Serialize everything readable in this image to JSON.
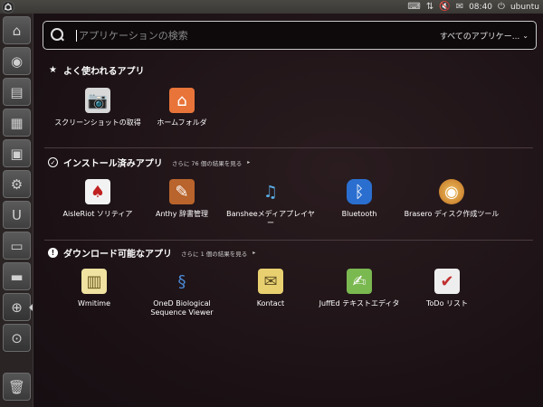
{
  "panel": {
    "clock": "08:40",
    "user": "ubuntu"
  },
  "search": {
    "placeholder": "アプリケーションの検索",
    "filter_label": "すべてのアプリケー..."
  },
  "sections": [
    {
      "title": "よく使われるアプリ",
      "more": "",
      "apps": [
        {
          "label": "スクリーンショットの取得",
          "icon": "camera-icon"
        },
        {
          "label": "ホームフォルダ",
          "icon": "home-folder-icon"
        }
      ]
    },
    {
      "title": "インストール済みアプリ",
      "more": "さらに 76 個の結果を見る",
      "apps": [
        {
          "label": "AisleRiot ソリティア",
          "icon": "cards-icon"
        },
        {
          "label": "Anthy 辞書管理",
          "icon": "dictionary-icon"
        },
        {
          "label": "Bansheeメディアプレイヤー",
          "icon": "banshee-icon"
        },
        {
          "label": "Bluetooth",
          "icon": "bluetooth-icon"
        },
        {
          "label": "Brasero ディスク作成ツール",
          "icon": "brasero-icon"
        }
      ]
    },
    {
      "title": "ダウンロード可能なアプリ",
      "more": "さらに 1 個の結果を見る",
      "apps": [
        {
          "label": "Wmitime",
          "icon": "wmitime-icon"
        },
        {
          "label": "OneD Biological Sequence Viewer",
          "icon": "onedbio-icon"
        },
        {
          "label": "Kontact",
          "icon": "kontact-icon"
        },
        {
          "label": "JuffEd テキストエディタ",
          "icon": "juffed-icon"
        },
        {
          "label": "ToDo リスト",
          "icon": "todo-icon"
        }
      ]
    }
  ],
  "launcher": {
    "items": [
      "home-folder-icon",
      "firefox-icon",
      "writer-icon",
      "calc-icon",
      "impress-icon",
      "settings-icon",
      "ubuntu-one-icon",
      "workspaces-icon",
      "terminal-icon",
      "zoom-in-icon",
      "zoom-icon",
      "trash-icon"
    ]
  }
}
